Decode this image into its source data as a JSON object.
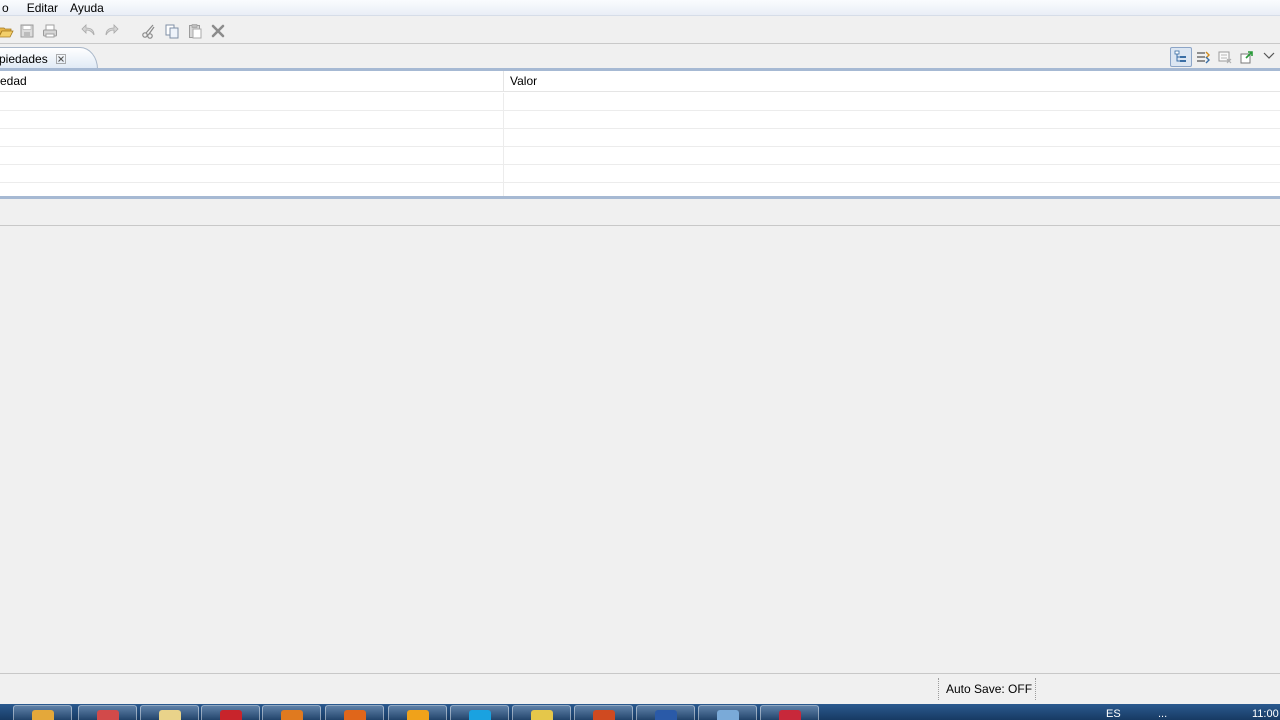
{
  "menubar": {
    "items": [
      "o",
      "Editar",
      "Ayuda"
    ]
  },
  "toolbar": {
    "buttons": [
      "open-icon",
      "save-icon",
      "print-icon",
      "undo-icon",
      "redo-icon",
      "cut-icon",
      "copy-icon",
      "paste-icon",
      "delete-icon"
    ]
  },
  "view": {
    "tab_label": "piedades",
    "actions": [
      "show-categories-icon",
      "show-advanced-icon",
      "restore-default-icon",
      "pin-icon",
      "view-menu-icon"
    ]
  },
  "table": {
    "columns": [
      "edad",
      "Valor"
    ],
    "rows": [
      [
        "",
        ""
      ],
      [
        "",
        ""
      ],
      [
        "",
        ""
      ],
      [
        "",
        ""
      ],
      [
        "",
        ""
      ]
    ]
  },
  "status": {
    "auto_save": "Auto Save: OFF"
  },
  "taskbar": {
    "apps": [
      "ie-icon",
      "paint-icon",
      "explorer-icon",
      "acrobat-icon",
      "firefox-icon",
      "basketball-icon",
      "puzzle-icon",
      "skype-icon",
      "shield-icon",
      "powerpoint-icon",
      "word-icon",
      "window-icon",
      "flash-icon"
    ],
    "tray_text": [
      "ES",
      "..."
    ],
    "clock": "11:00"
  },
  "colors": {
    "accent": "#a6b9d3",
    "taskbar": "#1f4673"
  }
}
